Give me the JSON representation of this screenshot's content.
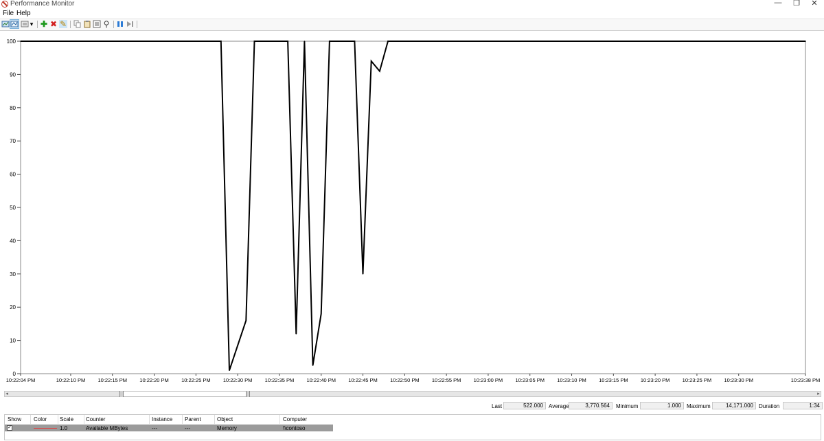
{
  "window": {
    "title": "Performance Monitor",
    "controls": {
      "minimize": "—",
      "restore": "❐",
      "close": "✕"
    }
  },
  "menu": {
    "items": [
      "File",
      "Help"
    ]
  },
  "toolbar": {
    "icons": [
      "view-current-activity-icon",
      "change-graph-type-icon",
      "dropdown-arrow-icon",
      "add-counter-icon",
      "delete-counter-icon",
      "highlight-icon",
      "copy-properties-icon",
      "paste-counter-list-icon",
      "properties-icon",
      "zoom-icon",
      "freeze-display-icon",
      "update-data-icon"
    ],
    "glyphs": {
      "dropdown": "▾",
      "add": "✚",
      "delete": "✖",
      "highlight": "✎",
      "zoom": "⚲"
    }
  },
  "chart_data": {
    "type": "line",
    "ylim": [
      0,
      100
    ],
    "y_ticks": [
      "0",
      "10",
      "20",
      "30",
      "40",
      "50",
      "60",
      "70",
      "80",
      "90",
      "100"
    ],
    "x_tick_labels": [
      "10:22:04 PM",
      "10:22:10 PM",
      "10:22:15 PM",
      "10:22:20 PM",
      "10:22:25 PM",
      "10:22:30 PM",
      "10:22:35 PM",
      "10:22:40 PM",
      "10:22:45 PM",
      "10:22:50 PM",
      "10:22:55 PM",
      "10:23:00 PM",
      "10:23:05 PM",
      "10:23:10 PM",
      "10:23:15 PM",
      "10:23:20 PM",
      "10:23:25 PM",
      "10:23:30 PM",
      "10:23:38 PM"
    ],
    "grid": false,
    "series": [
      {
        "counter": "Available MBytes",
        "color": "#000000",
        "points": [
          [
            "10:22:04 PM",
            100
          ],
          [
            "10:22:28 PM",
            100
          ],
          [
            "10:22:29 PM",
            1
          ],
          [
            "10:22:31 PM",
            16
          ],
          [
            "10:22:32 PM",
            100
          ],
          [
            "10:22:36 PM",
            100
          ],
          [
            "10:22:37 PM",
            12
          ],
          [
            "10:22:38 PM",
            100
          ],
          [
            "10:22:39 PM",
            2.5
          ],
          [
            "10:22:40 PM",
            18
          ],
          [
            "10:22:41 PM",
            100
          ],
          [
            "10:22:44 PM",
            100
          ],
          [
            "10:22:45 PM",
            30
          ],
          [
            "10:22:46 PM",
            94
          ],
          [
            "10:22:47 PM",
            91
          ],
          [
            "10:22:48 PM",
            100
          ],
          [
            "10:23:38 PM",
            100
          ]
        ]
      }
    ]
  },
  "stats": {
    "last_label": "Last",
    "last": "522.000",
    "average_label": "Average",
    "average": "3,770.564",
    "minimum_label": "Minimum",
    "minimum": "1.000",
    "maximum_label": "Maximum",
    "maximum": "14,171.000",
    "duration_label": "Duration",
    "duration": "1:34"
  },
  "legend": {
    "headers": {
      "show": "Show",
      "color": "Color",
      "scale": "Scale",
      "counter": "Counter",
      "instance": "Instance",
      "parent": "Parent",
      "object": "Object",
      "computer": "Computer"
    },
    "rows": [
      {
        "show": "✓",
        "color": "#e04040",
        "scale": "1.0",
        "counter": "Available MBytes",
        "instance": "---",
        "parent": "---",
        "object": "Memory",
        "computer": "\\\\contoso"
      }
    ]
  },
  "scrollbar": {
    "left_arrow": "◂",
    "right_arrow": "▸"
  }
}
